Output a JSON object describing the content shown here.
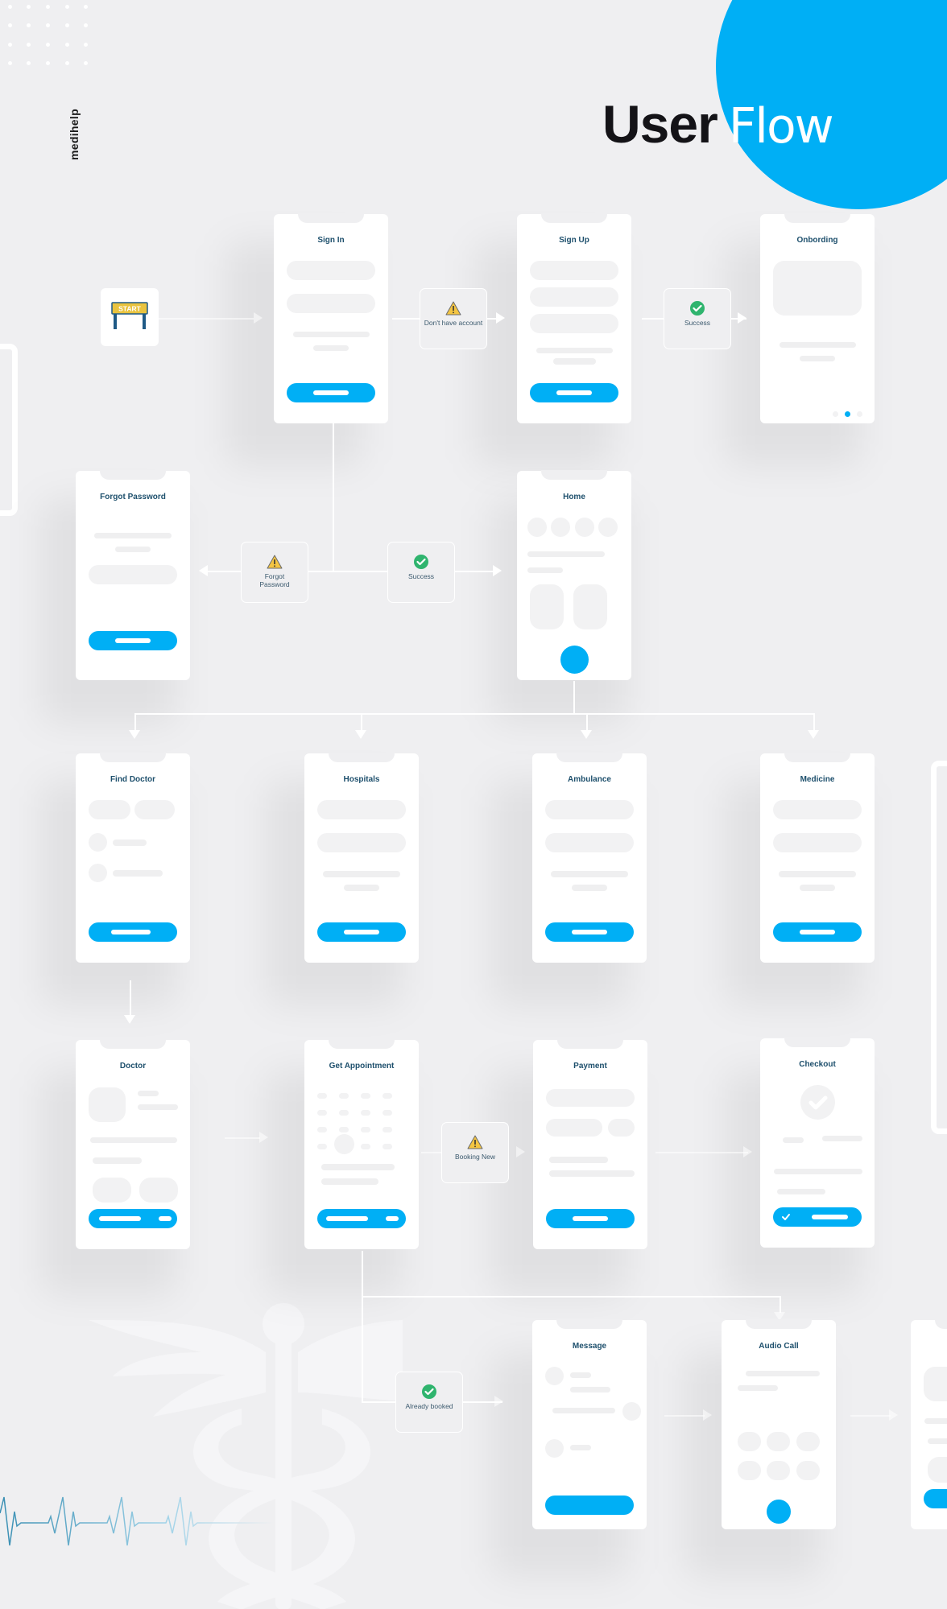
{
  "brand": "medihelp",
  "title": {
    "bold": "User",
    "light": "Flow"
  },
  "colors": {
    "accent": "#00aff5",
    "background": "#efeff1",
    "screen_title": "#1d4f6c",
    "success": "#2fb46e",
    "warning": "#f4c542"
  },
  "start": {
    "label": "START",
    "icon": "start-sign-icon"
  },
  "screens": {
    "sign_in": "Sign In",
    "sign_up": "Sign Up",
    "onboarding": "Onbording",
    "forgot_password": "Forgot Password",
    "home": "Home",
    "find_doctor": "Find Doctor",
    "hospitals": "Hospitals",
    "ambulance": "Ambulance",
    "medicine": "Medicine",
    "doctor": "Doctor",
    "get_appointment": "Get Appointment",
    "payment": "Payment",
    "checkout": "Checkout",
    "message": "Message",
    "audio_call": "Audio Call"
  },
  "onboarding_pager": {
    "pages": 3,
    "active_page": 2
  },
  "decisions": {
    "dont_have_account": {
      "label": "Don't have account",
      "icon": "warning-icon"
    },
    "signup_success": {
      "label": "Success",
      "icon": "check-circle-icon"
    },
    "forgot_password": {
      "label": "Forgot Password",
      "icon": "warning-icon"
    },
    "signin_success": {
      "label": "Success",
      "icon": "check-circle-icon"
    },
    "booking_new": {
      "label": "Booking New",
      "icon": "warning-icon"
    },
    "already_booked": {
      "label": "Already booked",
      "icon": "check-circle-icon"
    }
  },
  "decorations": [
    "dot-grid",
    "caduceus-watermark",
    "heartbeat-line"
  ]
}
